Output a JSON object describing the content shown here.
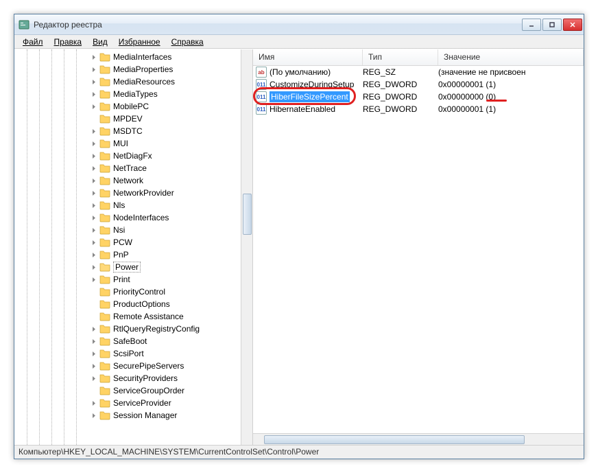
{
  "window": {
    "title": "Редактор реестра"
  },
  "menu": {
    "file": "Файл",
    "edit": "Правка",
    "view": "Вид",
    "favorites": "Избранное",
    "help": "Справка"
  },
  "tree": {
    "selected": "Power",
    "nodes": [
      {
        "label": "MediaInterfaces",
        "expandable": true
      },
      {
        "label": "MediaProperties",
        "expandable": true
      },
      {
        "label": "MediaResources",
        "expandable": true
      },
      {
        "label": "MediaTypes",
        "expandable": true
      },
      {
        "label": "MobilePC",
        "expandable": true
      },
      {
        "label": "MPDEV",
        "expandable": false
      },
      {
        "label": "MSDTC",
        "expandable": true
      },
      {
        "label": "MUI",
        "expandable": true
      },
      {
        "label": "NetDiagFx",
        "expandable": true
      },
      {
        "label": "NetTrace",
        "expandable": true
      },
      {
        "label": "Network",
        "expandable": true
      },
      {
        "label": "NetworkProvider",
        "expandable": true
      },
      {
        "label": "Nls",
        "expandable": true
      },
      {
        "label": "NodeInterfaces",
        "expandable": true
      },
      {
        "label": "Nsi",
        "expandable": true
      },
      {
        "label": "PCW",
        "expandable": true
      },
      {
        "label": "PnP",
        "expandable": true
      },
      {
        "label": "Power",
        "expandable": true,
        "selected": true,
        "open": true
      },
      {
        "label": "Print",
        "expandable": true
      },
      {
        "label": "PriorityControl",
        "expandable": false
      },
      {
        "label": "ProductOptions",
        "expandable": false
      },
      {
        "label": "Remote Assistance",
        "expandable": false
      },
      {
        "label": "RtlQueryRegistryConfig",
        "expandable": true
      },
      {
        "label": "SafeBoot",
        "expandable": true
      },
      {
        "label": "ScsiPort",
        "expandable": true
      },
      {
        "label": "SecurePipeServers",
        "expandable": true
      },
      {
        "label": "SecurityProviders",
        "expandable": true
      },
      {
        "label": "ServiceGroupOrder",
        "expandable": false
      },
      {
        "label": "ServiceProvider",
        "expandable": true
      },
      {
        "label": "Session Manager",
        "expandable": true
      }
    ]
  },
  "list": {
    "headers": {
      "name": "Имя",
      "type": "Тип",
      "value": "Значение"
    },
    "rows": [
      {
        "icon": "sz",
        "name": "(По умолчанию)",
        "type": "REG_SZ",
        "value": "(значение не присвоен",
        "selected": false
      },
      {
        "icon": "dw",
        "name": "CustomizeDuringSetup",
        "type": "REG_DWORD",
        "value": "0x00000001 (1)",
        "selected": false
      },
      {
        "icon": "dw",
        "name": "HiberFileSizePercent",
        "type": "REG_DWORD",
        "value": "0x00000000 (0)",
        "selected": true,
        "highlighted": true,
        "underlineValue": true
      },
      {
        "icon": "dw",
        "name": "HibernateEnabled",
        "type": "REG_DWORD",
        "value": "0x00000001 (1)",
        "selected": false
      }
    ]
  },
  "statusbar": {
    "path": "Компьютер\\HKEY_LOCAL_MACHINE\\SYSTEM\\CurrentControlSet\\Control\\Power"
  }
}
